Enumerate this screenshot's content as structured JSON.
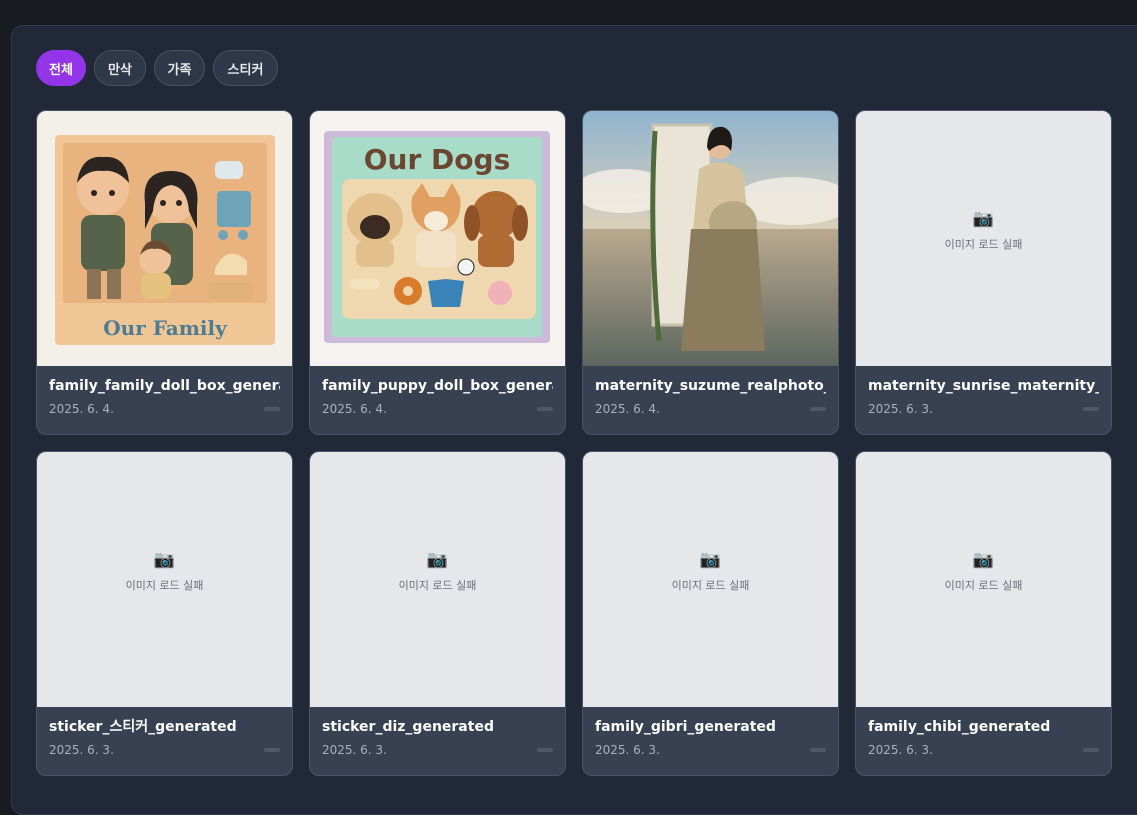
{
  "filters": [
    {
      "label": "전체",
      "active": true
    },
    {
      "label": "만삭",
      "active": false
    },
    {
      "label": "가족",
      "active": false
    },
    {
      "label": "스티커",
      "active": false
    }
  ],
  "fail_text": "이미지 로드 실패",
  "box_titles": {
    "family": "Our Family",
    "dogs": "Our Dogs"
  },
  "cards": [
    {
      "name": "family_family_doll_box_generated",
      "date": "2025. 6. 4.",
      "thumb": "family-box"
    },
    {
      "name": "family_puppy_doll_box_generated",
      "date": "2025. 6. 4.",
      "thumb": "dogs-box"
    },
    {
      "name": "maternity_suzume_realphoto_maternity",
      "date": "2025. 6. 4.",
      "thumb": "maternity-photo"
    },
    {
      "name": "maternity_sunrise_maternity_generated",
      "date": "2025. 6. 3.",
      "thumb": "failed"
    },
    {
      "name": "sticker_스티커_generated",
      "date": "2025. 6. 3.",
      "thumb": "failed"
    },
    {
      "name": "sticker_diz_generated",
      "date": "2025. 6. 3.",
      "thumb": "failed"
    },
    {
      "name": "family_gibri_generated",
      "date": "2025. 6. 3.",
      "thumb": "failed"
    },
    {
      "name": "family_chibi_generated",
      "date": "2025. 6. 3.",
      "thumb": "failed"
    }
  ]
}
